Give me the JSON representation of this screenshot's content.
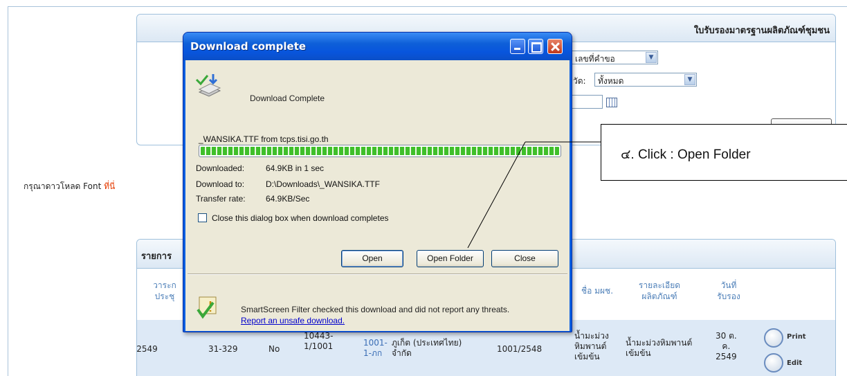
{
  "top_panel": {
    "title": "ใบรับรองมาตรฐานผลิตภัณฑ์ชุมชน",
    "search_type_value": "เลขที่คำขอ",
    "province_label": "วัด:",
    "province_value": "ทั้งหมด"
  },
  "font_note": {
    "text": "กรุณาดาวโหลด Font",
    "link": "ที่นี่"
  },
  "results": {
    "title": "รายการ",
    "columns": {
      "meeting": [
        "วาระก",
        "ประชุ"
      ],
      "standard_name": "ชื่อ มผช.",
      "product_detail": [
        "รายละเอียด",
        "ผลิตภัณฑ์"
      ],
      "cert_date": [
        "วันที่",
        "รับรอง"
      ]
    },
    "row": {
      "meeting": "31-9/2549",
      "cert_no": "31-329",
      "flag": "No",
      "request_no": [
        "10443-",
        "1/1001"
      ],
      "code": [
        "1001-",
        "1-ภก"
      ],
      "company": [
        "ภูเก็ต (ประเทศไทย)",
        "จำกัด"
      ],
      "standard_no": "1001/2548",
      "standard_name": [
        "น้ำมะม่วง",
        "หิมพานต์",
        "เข้มข้น"
      ],
      "product": [
        "น้ำมะม่วงหิมพานต์",
        "เข้มข้น"
      ],
      "date": [
        "30 ต.",
        "ค.",
        "2549"
      ],
      "print_label": "Print",
      "edit_label": "Edit"
    }
  },
  "dialog": {
    "title": "Download complete",
    "heading": "Download Complete",
    "file_line": "_WANSIKA.TTF from tcps.tisi.go.th",
    "progress_fraction": 1.0,
    "downloaded_label": "Downloaded:",
    "downloaded_value": "64.9KB in 1 sec",
    "download_to_label": "Download to:",
    "download_to_value": "D:\\Downloads\\_WANSIKA.TTF",
    "rate_label": "Transfer rate:",
    "rate_value": "64.9KB/Sec",
    "close_when_done": "Close this dialog box when download completes",
    "open_btn": "Open",
    "open_folder_btn": "Open Folder",
    "close_btn": "Close",
    "smartscreen_text": "SmartScreen Filter checked this download and did not report any threats.",
    "smartscreen_link": "Report an unsafe download."
  },
  "callout": {
    "text": "๔. Click : Open Folder"
  },
  "colors": {
    "title_bar": "#0a5ee0",
    "header_text": "#4d7fb8",
    "link": "#e53a00"
  }
}
